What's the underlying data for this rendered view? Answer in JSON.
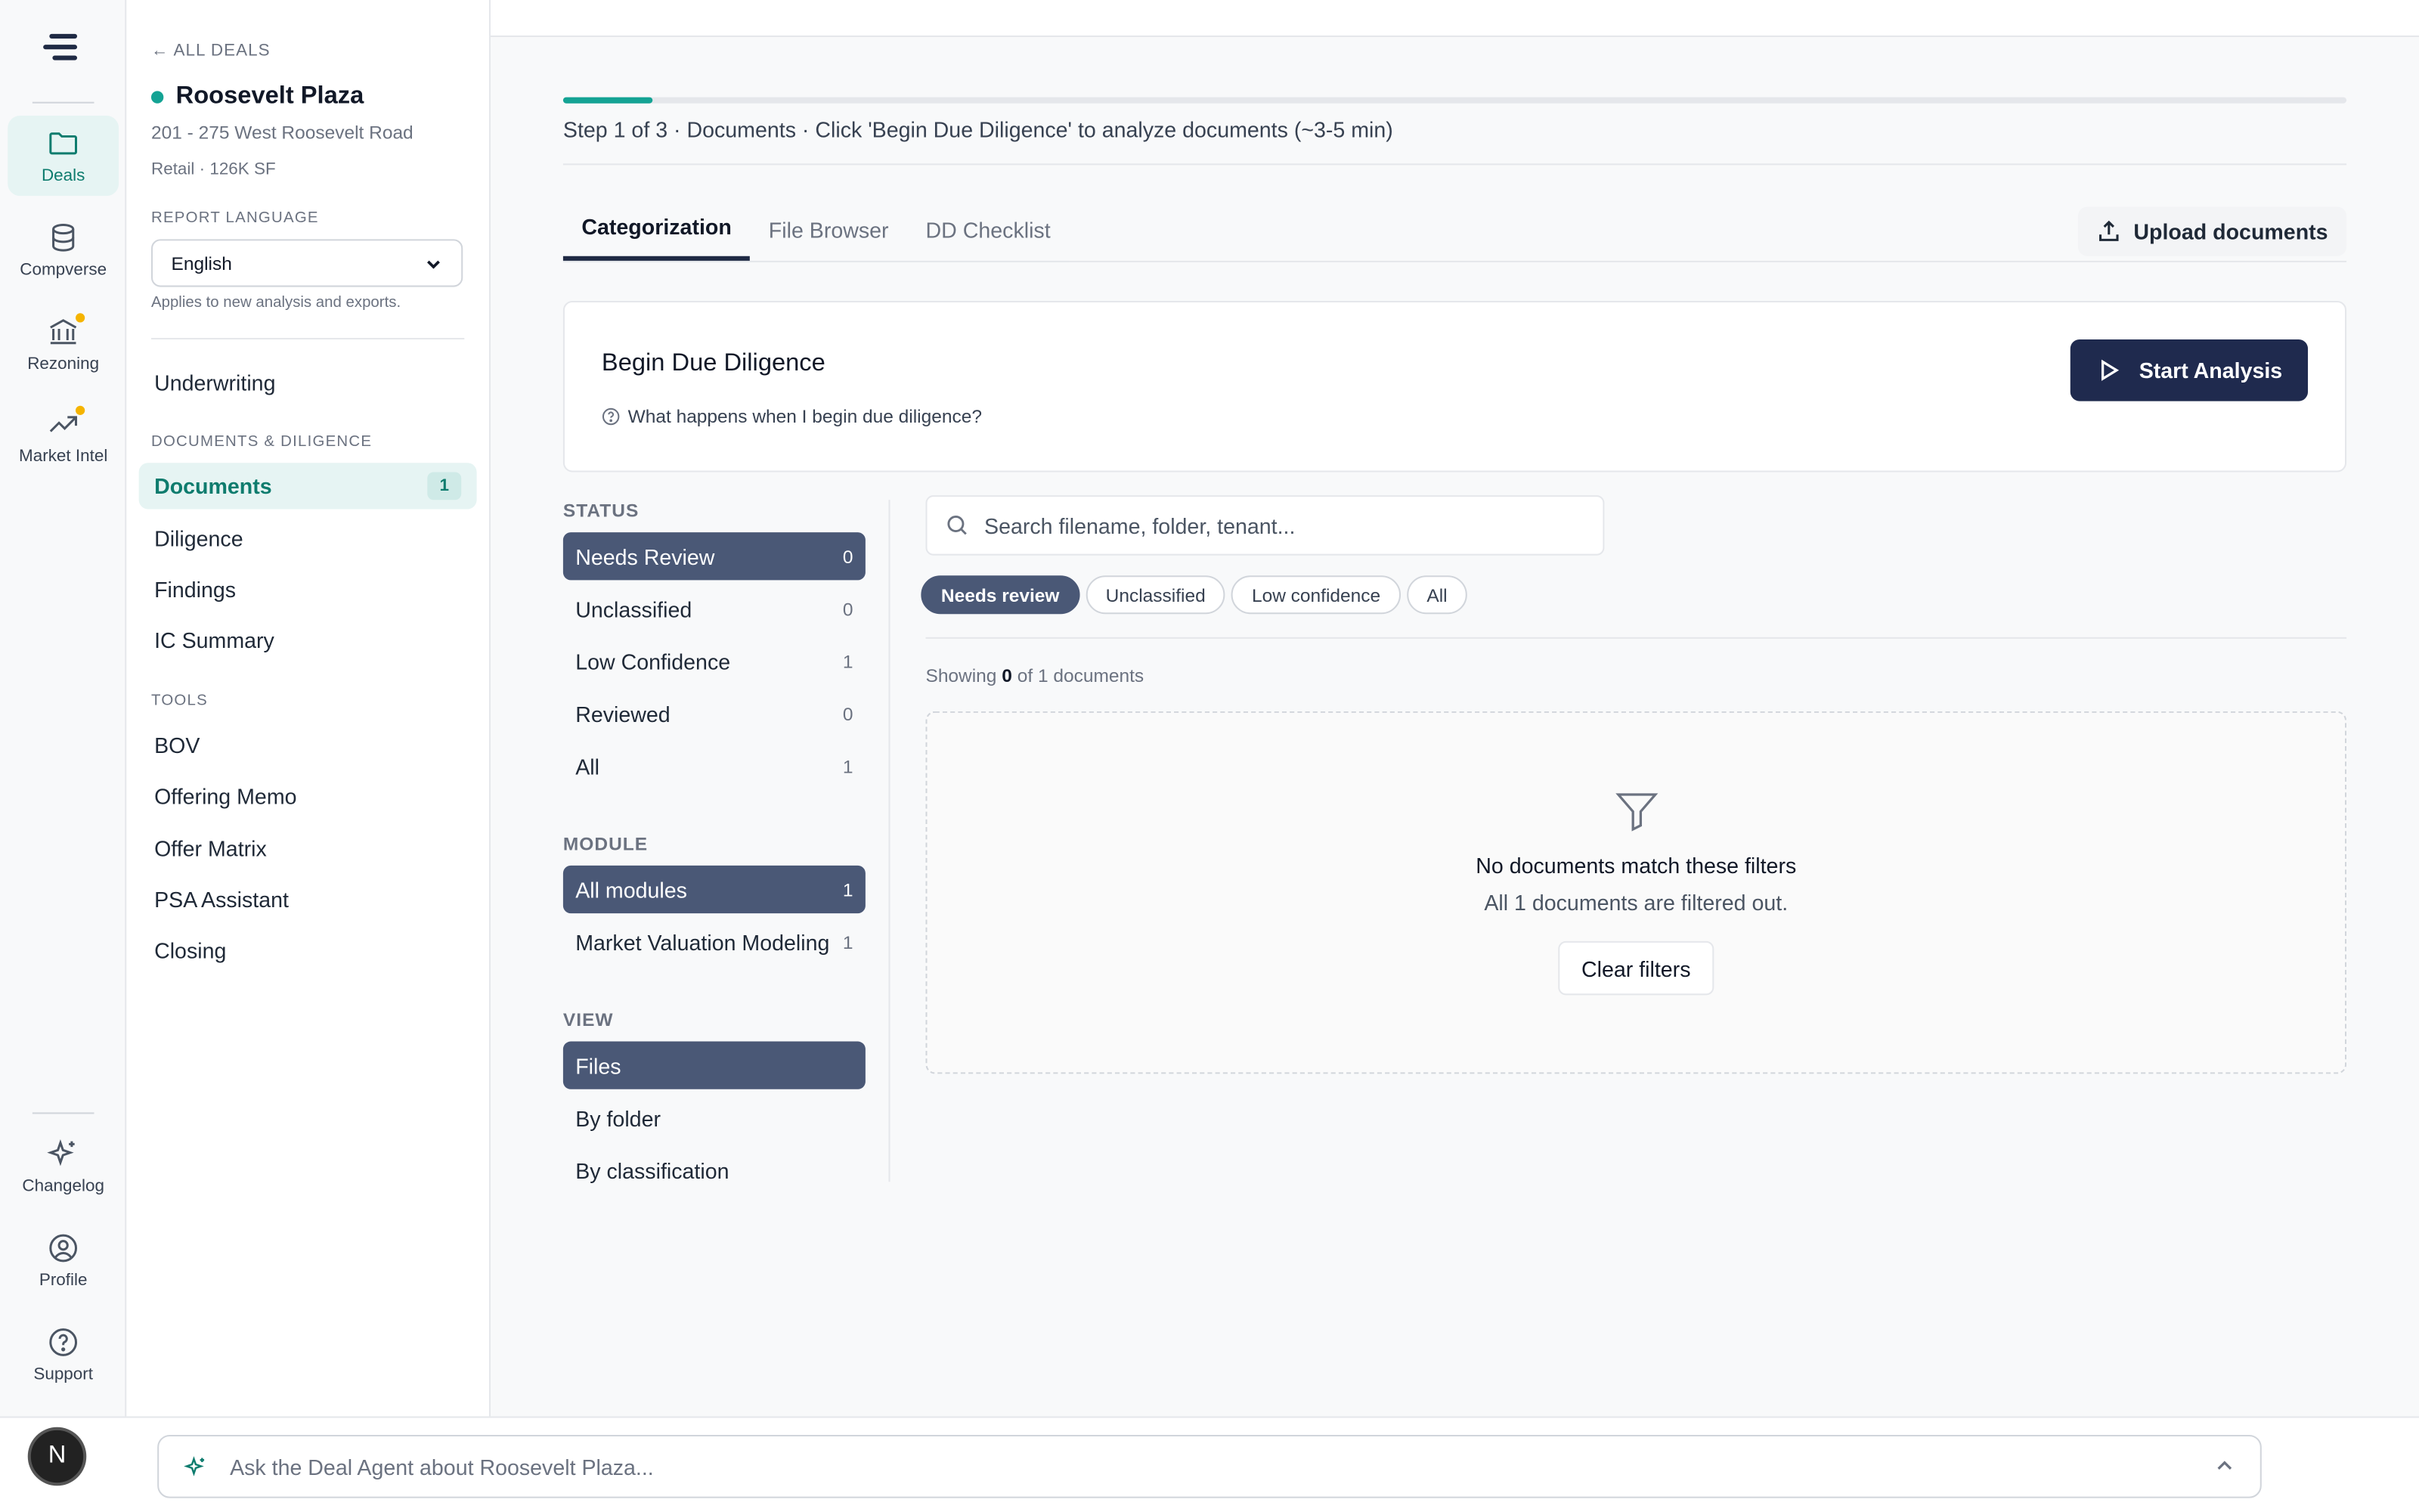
{
  "rail": {
    "items": [
      {
        "label": "Deals",
        "icon": "folder-icon",
        "active": true
      },
      {
        "label": "Compverse",
        "icon": "database-icon"
      },
      {
        "label": "Rezoning",
        "icon": "bank-icon",
        "dot": true
      },
      {
        "label": "Market Intel",
        "icon": "trend-up-icon",
        "dot": true
      }
    ],
    "bottom_items": [
      {
        "label": "Changelog",
        "icon": "sparkle-icon"
      },
      {
        "label": "Profile",
        "icon": "user-circle-icon"
      },
      {
        "label": "Support",
        "icon": "help-circle-icon"
      }
    ],
    "accent_dot_color": "#f5b400"
  },
  "deal": {
    "back_label": "← ALL DEALS",
    "name": "Roosevelt Plaza",
    "address": "201 - 275 West Roosevelt Road",
    "meta": "Retail · 126K SF",
    "report_language_label": "REPORT LANGUAGE",
    "language_value": "English",
    "language_note": "Applies to new analysis and exports."
  },
  "nav": {
    "underwriting": "Underwriting",
    "docs_section": "DOCUMENTS & DILIGENCE",
    "documents": "Documents",
    "documents_badge": "1",
    "diligence": "Diligence",
    "findings": "Findings",
    "ic_summary": "IC Summary",
    "tools_section": "TOOLS",
    "bov": "BOV",
    "offering_memo": "Offering Memo",
    "offer_matrix": "Offer Matrix",
    "psa_assistant": "PSA Assistant",
    "closing": "Closing"
  },
  "progress": {
    "fraction": 0.05,
    "step_text": "Step 1 of 3 · Documents  ·  Click 'Begin Due Diligence' to analyze documents (~3-5 min)"
  },
  "tabs": {
    "categorization": "Categorization",
    "file_browser": "File Browser",
    "dd_checklist": "DD Checklist",
    "upload": "Upload documents"
  },
  "dd": {
    "title": "Begin Due Diligence",
    "help": "What happens when I begin due diligence?",
    "start": "Start Analysis"
  },
  "filters": {
    "status_label": "STATUS",
    "status": [
      {
        "label": "Needs Review",
        "count": "0",
        "active": true
      },
      {
        "label": "Unclassified",
        "count": "0"
      },
      {
        "label": "Low Confidence",
        "count": "1"
      },
      {
        "label": "Reviewed",
        "count": "0"
      },
      {
        "label": "All",
        "count": "1"
      }
    ],
    "module_label": "MODULE",
    "modules": [
      {
        "label": "All modules",
        "count": "1",
        "active": true
      },
      {
        "label": "Market Valuation Modeling",
        "count": "1"
      }
    ],
    "view_label": "VIEW",
    "views": [
      {
        "label": "Files",
        "active": true
      },
      {
        "label": "By folder"
      },
      {
        "label": "By classification"
      }
    ]
  },
  "docs": {
    "search_placeholder": "Search filename, folder, tenant...",
    "chips": [
      "Needs review",
      "Unclassified",
      "Low confidence",
      "All"
    ],
    "showing_prefix": "Showing",
    "showing_count": "0",
    "showing_suffix": "of 1 documents",
    "empty_title": "No documents match these filters",
    "empty_sub": "All 1 documents are filtered out.",
    "clear": "Clear filters"
  },
  "bottom": {
    "avatar_letter": "N",
    "agent_placeholder": "Ask the Deal Agent about Roosevelt Plaza..."
  },
  "colors": {
    "accent": "#14a394",
    "primary_dark": "#1f2a4e",
    "active_filter": "#4a5876"
  }
}
